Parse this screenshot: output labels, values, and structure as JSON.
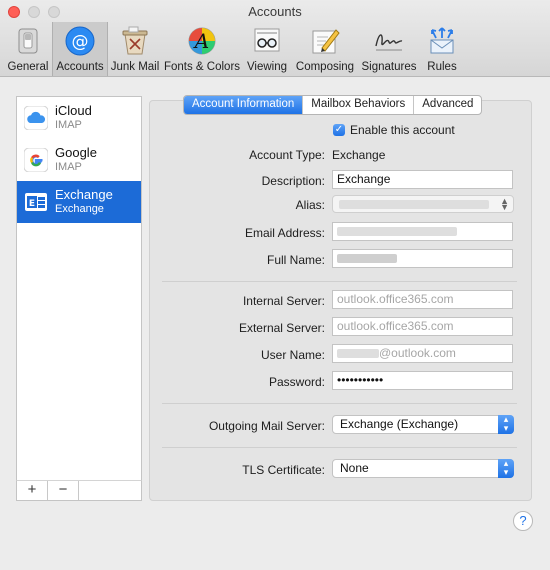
{
  "window": {
    "title": "Accounts"
  },
  "toolbar": {
    "tabs": [
      {
        "label": "General",
        "icon": "switch-icon"
      },
      {
        "label": "Accounts",
        "icon": "at-sign-icon",
        "selected": true
      },
      {
        "label": "Junk Mail",
        "icon": "trash-can-icon"
      },
      {
        "label": "Fonts & Colors",
        "icon": "font-palette-icon"
      },
      {
        "label": "Viewing",
        "icon": "glasses-icon"
      },
      {
        "label": "Composing",
        "icon": "pencil-icon"
      },
      {
        "label": "Signatures",
        "icon": "signature-icon"
      },
      {
        "label": "Rules",
        "icon": "envelope-arrows-icon"
      }
    ]
  },
  "accounts": [
    {
      "name": "iCloud",
      "type": "IMAP",
      "icon": "icloud-icon"
    },
    {
      "name": "Google",
      "type": "IMAP",
      "icon": "google-icon"
    },
    {
      "name": "Exchange",
      "type": "Exchange",
      "icon": "exchange-icon",
      "selected": true
    }
  ],
  "list_buttons": {
    "add": "+",
    "remove": "−"
  },
  "segments": {
    "items": [
      "Account Information",
      "Mailbox Behaviors",
      "Advanced"
    ],
    "selected": "Account Information"
  },
  "form": {
    "enable_label": "Enable this account",
    "enable_checked": true,
    "account_type_label": "Account Type:",
    "account_type_value": "Exchange",
    "description_label": "Description:",
    "description_value": "Exchange",
    "alias_label": "Alias:",
    "email_label": "Email Address:",
    "fullname_label": "Full Name:",
    "internal_server_label": "Internal Server:",
    "internal_server_placeholder": "outlook.office365.com",
    "external_server_label": "External Server:",
    "external_server_placeholder": "outlook.office365.com",
    "username_label": "User Name:",
    "username_suffix": "@outlook.com",
    "password_label": "Password:",
    "password_value": "•••••••••••",
    "outgoing_label": "Outgoing Mail Server:",
    "outgoing_value": "Exchange (Exchange)",
    "tls_label": "TLS Certificate:",
    "tls_value": "None"
  },
  "help": "?",
  "colors": {
    "accent": "#1e72e6",
    "selection": "#1c6bd7"
  }
}
